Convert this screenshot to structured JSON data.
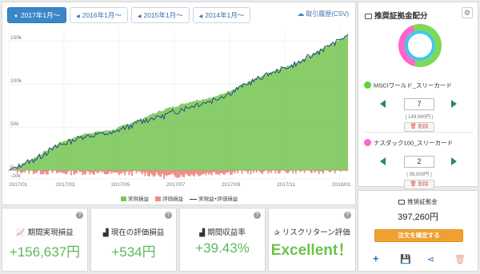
{
  "tabs": [
    {
      "label": "2017年1月〜",
      "active": true
    },
    {
      "label": "2016年1月〜",
      "active": false
    },
    {
      "label": "2015年1月〜",
      "active": false
    },
    {
      "label": "2014年1月〜",
      "active": false
    }
  ],
  "csv_label": "取引履歴(CSV)",
  "legend": {
    "realized": "実現損益",
    "unrealized": "評価損益",
    "total": "実現益+評価損益"
  },
  "colors": {
    "realized": "#7cc85a",
    "unrealized": "#f08a80",
    "total_line": "#1e3d8a",
    "accent": "#3a87c8"
  },
  "chart_data": {
    "type": "area",
    "title": "",
    "xlabel": "",
    "ylabel": "",
    "x_ticks": [
      "2017/01",
      "2017/03",
      "2017/05",
      "2017/07",
      "2017/09",
      "2017/11",
      "2018/01"
    ],
    "y_ticks": [
      "-10k",
      "0",
      "50k",
      "100k",
      "150k"
    ],
    "ylim": [
      -10000,
      165000
    ],
    "grid": true,
    "legend_position": "bottom",
    "series": [
      {
        "name": "実現損益",
        "x": [
          "2017/01",
          "2017/02",
          "2017/03",
          "2017/04",
          "2017/05",
          "2017/06",
          "2017/07",
          "2017/08",
          "2017/09",
          "2017/10",
          "2017/11",
          "2017/12",
          "2018/01",
          "2018/01"
        ],
        "values": [
          0,
          15000,
          33000,
          43000,
          47000,
          59000,
          71000,
          80000,
          86000,
          100000,
          113000,
          124000,
          141000,
          157000
        ]
      },
      {
        "name": "評価損益",
        "x": [
          "2017/01",
          "2017/02",
          "2017/03",
          "2017/04",
          "2017/05",
          "2017/06",
          "2017/07",
          "2017/08",
          "2017/09",
          "2017/10",
          "2017/11",
          "2017/12",
          "2018/01",
          "2018/01"
        ],
        "values": [
          0,
          -2000,
          -3000,
          -2500,
          -4000,
          -3000,
          -7000,
          -5000,
          -3000,
          -2000,
          -1500,
          -1000,
          -1500,
          534
        ]
      },
      {
        "name": "実現益+評価損益",
        "x": [
          "2017/01",
          "2017/02",
          "2017/03",
          "2017/04",
          "2017/05",
          "2017/06",
          "2017/07",
          "2017/08",
          "2017/09",
          "2017/10",
          "2017/11",
          "2017/12",
          "2018/01",
          "2018/01"
        ],
        "values": [
          0,
          13000,
          30000,
          40500,
          43000,
          56000,
          64000,
          75000,
          83000,
          98000,
          111500,
          123000,
          139500,
          157171
        ]
      }
    ]
  },
  "stats": [
    {
      "title": "期間実現損益",
      "value": "+156,637円",
      "icon": "line-chart-icon"
    },
    {
      "title": "現在の評価損益",
      "value": "+534円",
      "icon": "area-chart-icon"
    },
    {
      "title": "期間収益率",
      "value": "+39.43%",
      "icon": "area-chart-icon"
    },
    {
      "title": "リスクリターン評価",
      "value": "Excellent！",
      "icon": "star-icon"
    }
  ],
  "allocation": {
    "title": "推奨証拠金配分",
    "donut": [
      {
        "name": "MSCIワールド_スリーカード",
        "share": 0.6,
        "color": "#7ed957"
      },
      {
        "name": "ナスダック100_スリーカード",
        "share": 0.4,
        "color": "#ff66cc"
      }
    ],
    "funds": [
      {
        "name": "MSCIワールド_スリーカード",
        "qty": "7",
        "price": "( 149,940円 )",
        "delete": "削除",
        "color": "#5bd63a"
      },
      {
        "name": "ナスダック100_スリーカード",
        "qty": "2",
        "price": "( 99,900円 )",
        "delete": "削除",
        "color": "#ff66cc"
      }
    ]
  },
  "order": {
    "title": "推奨証拠金",
    "amount": "397,260円",
    "button": "注文を確定する"
  }
}
